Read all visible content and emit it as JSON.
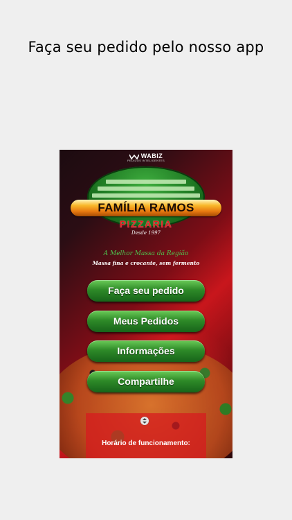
{
  "caption": "Faça seu pedido pelo nosso app",
  "brand": {
    "name": "WABIZ",
    "tagline": "PEDIDOS INTELIGENTES"
  },
  "logo": {
    "title": "FAMÍLIA RAMOS",
    "subtitle": "PIZZARIA",
    "since": "Desde 1997"
  },
  "slogan": {
    "line1": "A Melhor Massa da Região",
    "line2": "Massa fina e crocante, sem fermento"
  },
  "menu": {
    "order": "Faça seu pedido",
    "my_orders": "Meus Pedidos",
    "info": "Informações",
    "share": "Compartilhe"
  },
  "hours": {
    "label": "Horário de funcionamento:"
  },
  "icons": {
    "expand": "expand-collapse-icon"
  },
  "colors": {
    "accent_green": "#2e8a28",
    "accent_red": "#e31c1f"
  }
}
